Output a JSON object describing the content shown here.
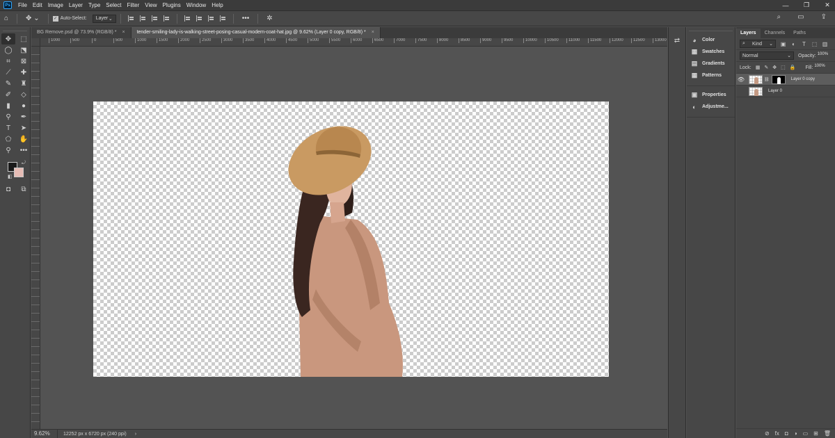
{
  "app": {
    "logo": "Ps"
  },
  "menu": [
    "File",
    "Edit",
    "Image",
    "Layer",
    "Type",
    "Select",
    "Filter",
    "View",
    "Plugins",
    "Window",
    "Help"
  ],
  "window_controls": [
    "—",
    "❐",
    "✕"
  ],
  "options_bar": {
    "auto_select_label": "Auto-Select:",
    "auto_select_target": "Layer",
    "more": "•••"
  },
  "tabs": [
    {
      "label": "BG Remove.psd @ 73.9% (RGB/8) *",
      "close": "×",
      "active": false
    },
    {
      "label": "tender-smiling-lady-is-walking-street-posing-casual-modern-coat-hat.jpg @ 9.62% (Layer 0 copy, RGB/8) *",
      "close": "×",
      "active": true
    }
  ],
  "ruler_ticks": [
    "1000",
    "500",
    "0",
    "500",
    "1000",
    "1500",
    "2000",
    "2500",
    "3000",
    "3500",
    "4000",
    "4500",
    "5000",
    "5500",
    "6000",
    "6500",
    "7000",
    "7500",
    "8000",
    "8500",
    "9000",
    "9500",
    "10000",
    "10500",
    "11000",
    "11500",
    "12000",
    "12500",
    "13000"
  ],
  "status": {
    "zoom": "9.62%",
    "doc_size": "12252 px x 6720 px (240 ppi)",
    "arrow": "›"
  },
  "colors": {
    "foreground": "#1a1a1a",
    "background": "#e6bcb5"
  },
  "collapsed_panels": [
    {
      "label": "Color",
      "icon": "color-wheel-icon",
      "glyph": "◕"
    },
    {
      "label": "Swatches",
      "icon": "swatches-grid-icon",
      "glyph": "▦"
    },
    {
      "label": "Gradients",
      "icon": "gradient-icon",
      "glyph": "▤"
    },
    {
      "label": "Patterns",
      "icon": "patterns-grid-icon",
      "glyph": "▦"
    },
    {
      "label": "Properties",
      "icon": "properties-icon",
      "glyph": "▣"
    },
    {
      "label": "Adjustme...",
      "icon": "adjustments-icon",
      "glyph": "◐"
    }
  ],
  "layers_panel": {
    "tabs": [
      "Layers",
      "Channels",
      "Paths"
    ],
    "kind": "Kind",
    "blend_mode": "Normal",
    "opacity_label": "Opacity:",
    "opacity": "100%",
    "lock_label": "Lock:",
    "fill_label": "Fill:",
    "fill": "100%",
    "layers": [
      {
        "name": "Layer 0 copy",
        "visible": true,
        "has_mask": true,
        "selected": true
      },
      {
        "name": "Layer 0",
        "visible": false,
        "has_mask": false,
        "selected": false
      }
    ],
    "footer_icons": [
      "⊘",
      "fx",
      "◘",
      "◑",
      "▭",
      "⊞",
      "🗑"
    ]
  }
}
